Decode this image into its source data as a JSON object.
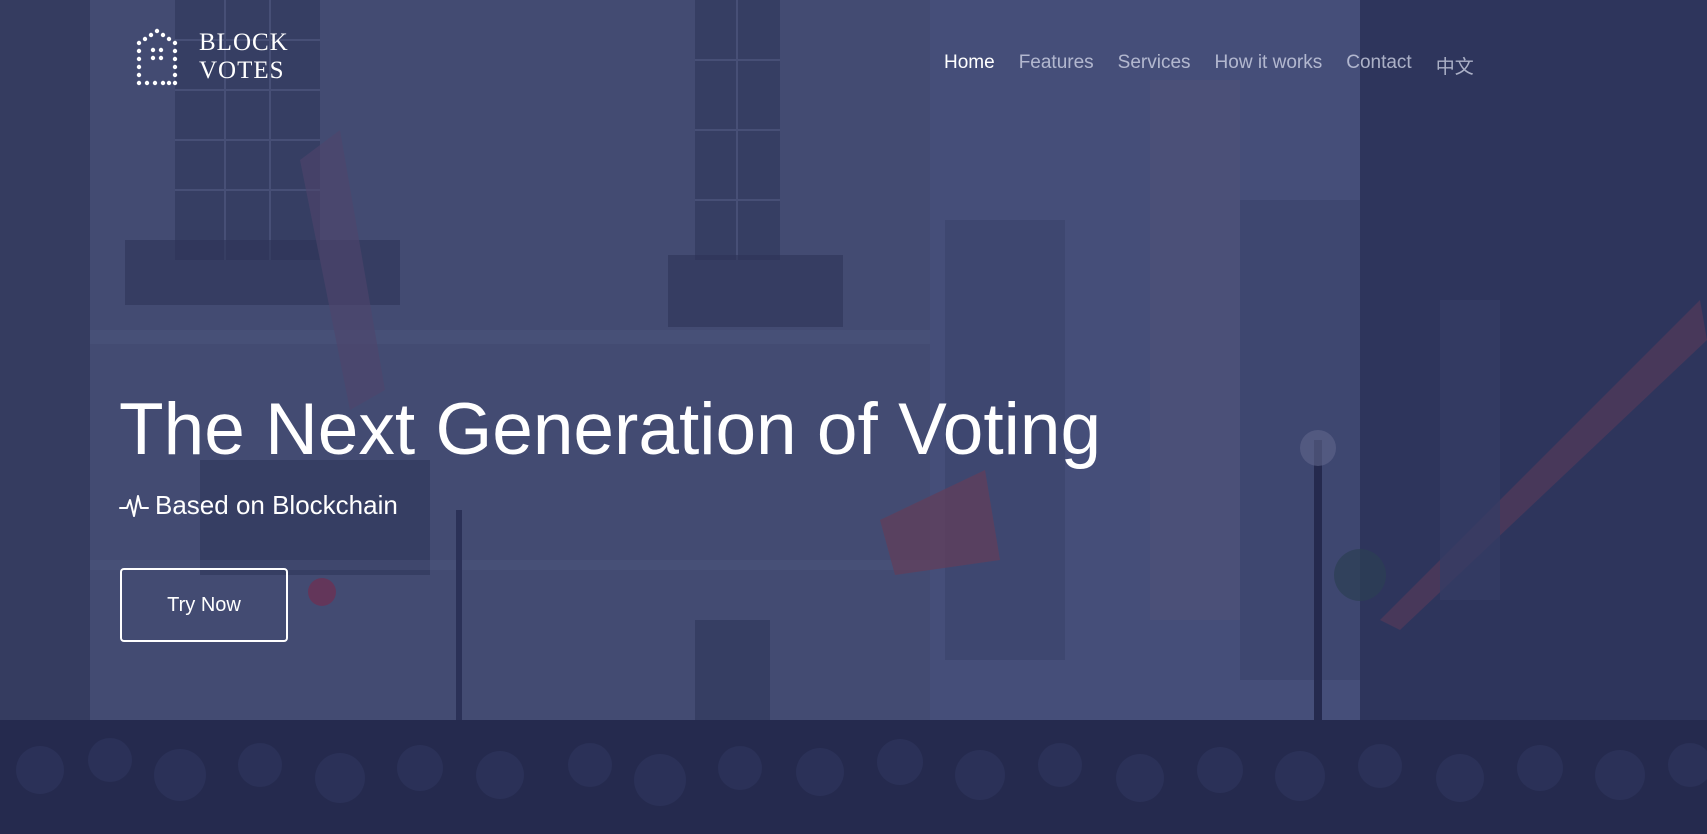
{
  "brand": {
    "line1": "BLOCK",
    "line2": "VOTES",
    "logo_icon": "house-dotted-icon"
  },
  "nav": {
    "items": [
      {
        "label": "Home",
        "active": true
      },
      {
        "label": "Features",
        "active": false
      },
      {
        "label": "Services",
        "active": false
      },
      {
        "label": "How it works",
        "active": false
      },
      {
        "label": "Contact",
        "active": false
      },
      {
        "label": "中文",
        "active": false
      }
    ]
  },
  "hero": {
    "headline": "The Next Generation of Voting",
    "subline": "Based on Blockchain",
    "subline_icon": "pulse-icon",
    "cta_label": "Try Now"
  },
  "colors": {
    "overlay": "#2c3460",
    "text": "#ffffff",
    "nav_inactive": "#dce0f0"
  }
}
